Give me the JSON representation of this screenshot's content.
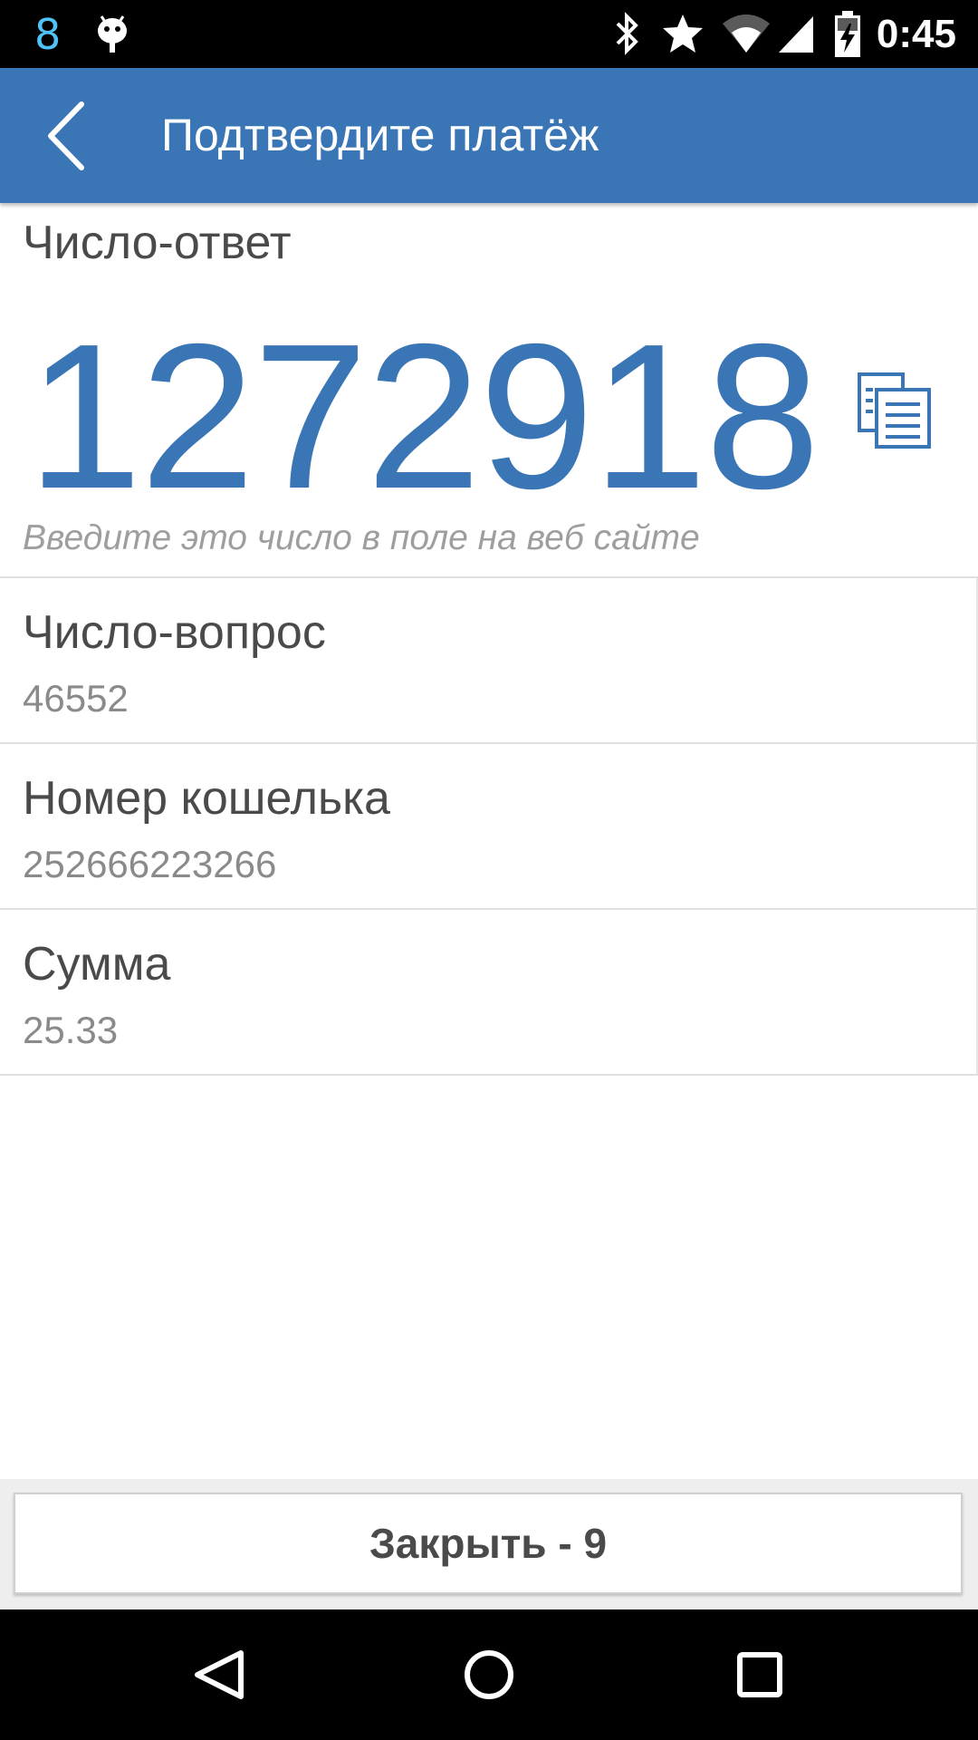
{
  "status_bar": {
    "notification_count": "8",
    "time": "0:45",
    "icons": [
      "android-debug-icon",
      "bluetooth-icon",
      "star-icon",
      "wifi-icon",
      "signal-icon",
      "battery-charging-icon"
    ]
  },
  "app_bar": {
    "title": "Подтвердите платёж",
    "back_icon": "chevron-left-icon",
    "background_color": "#3a76b6"
  },
  "answer": {
    "label": "Число-ответ",
    "value": "1272918",
    "hint": "Введите это число в поле на веб сайте",
    "copy_icon": "copy-icon",
    "accent_color": "#3a76b6"
  },
  "details": [
    {
      "label": "Число-вопрос",
      "value": "46552"
    },
    {
      "label": "Номер кошелька",
      "value": "252666223266"
    },
    {
      "label": "Сумма",
      "value": "25.33"
    }
  ],
  "footer": {
    "close_label": "Закрыть - 9"
  },
  "nav_bar": {
    "icons": [
      "back-triangle-icon",
      "home-circle-icon",
      "recents-square-icon"
    ]
  }
}
